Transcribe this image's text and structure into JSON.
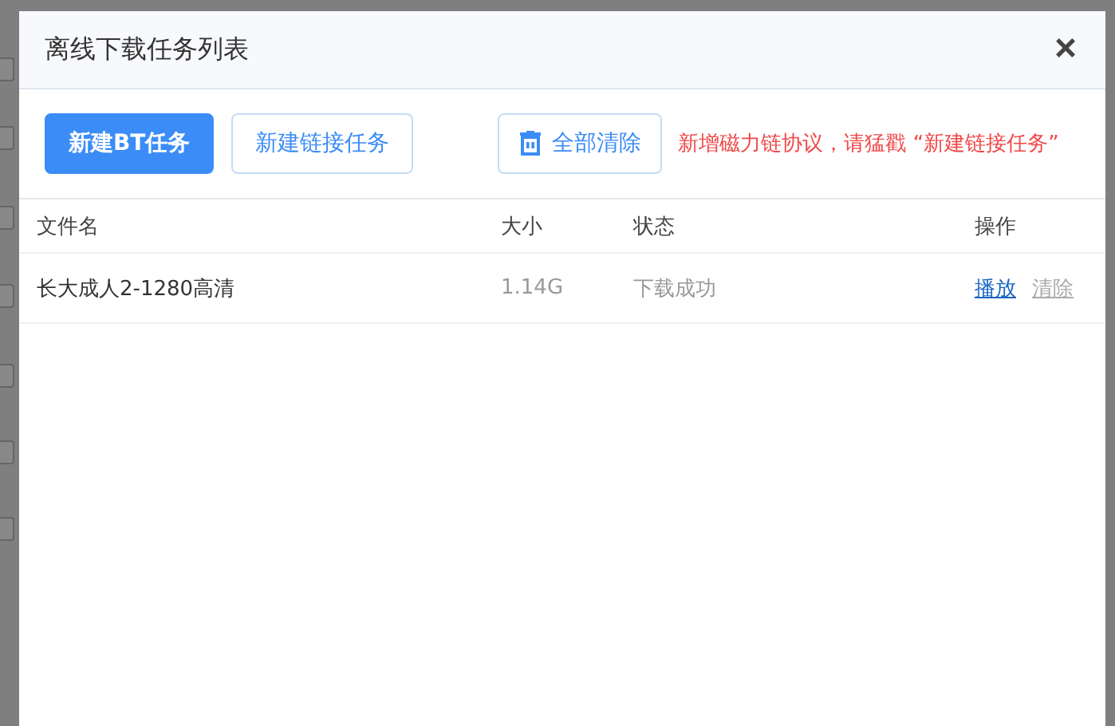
{
  "background_page": {
    "row_checkboxes": [
      {
        "checked": false
      },
      {
        "checked": false
      },
      {
        "checked": false
      },
      {
        "checked": false
      },
      {
        "checked": false
      },
      {
        "checked": false
      },
      {
        "checked": false
      }
    ]
  },
  "dialog": {
    "title": "离线下载任务列表",
    "close": "×",
    "toolbar": {
      "buttons": [
        {
          "kind": "primary",
          "label": "新建BT任务"
        },
        {
          "kind": "outline",
          "label": "新建链接任务"
        }
      ],
      "clear_all": "全部清除",
      "notice": "新增磁力链协议，请猛戳 “新建链接任务”"
    },
    "table": {
      "columns": [
        "文件名",
        "大小",
        "状态",
        "操作"
      ],
      "rows": [
        {
          "name": "长大成人2-1280高清",
          "size": "1.14G",
          "status": "下载成功",
          "actions": [
            {
              "kind": "link",
              "label": "播放"
            },
            {
              "kind": "muted",
              "label": "清除"
            }
          ]
        }
      ]
    }
  }
}
